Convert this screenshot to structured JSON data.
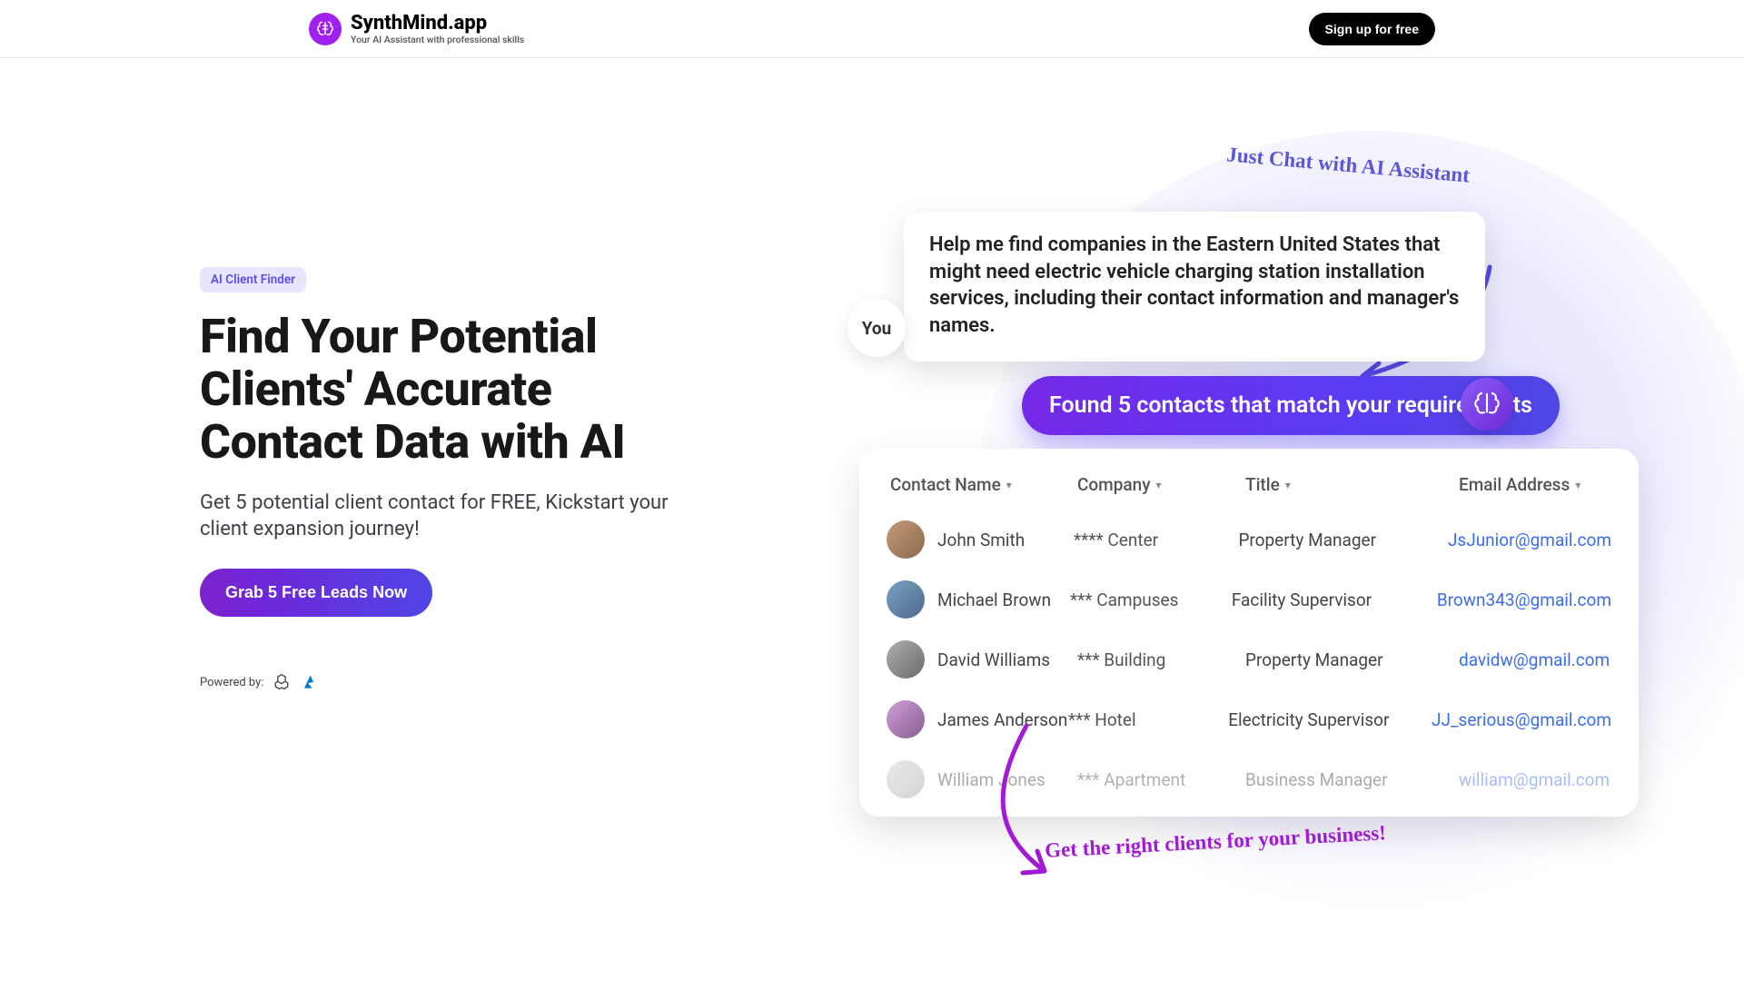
{
  "header": {
    "brand": "SynthMind.app",
    "tagline": "Your AI Assistant with professional skills",
    "signup": "Sign up for free"
  },
  "hero": {
    "badge": "AI Client Finder",
    "headline": "Find Your Potential Clients' Accurate Contact Data with AI",
    "subcopy": "Get 5 potential client contact for FREE, Kickstart your client expansion journey!",
    "cta": "Grab 5 Free Leads Now",
    "powered_label": "Powered by:"
  },
  "illustration": {
    "prompt": "Help me find companies in the Eastern United States that might need electric vehicle charging station installation services, including their contact information and manager's names.",
    "you_label": "You",
    "note_top": "Just Chat with AI Assistant",
    "response": "Found 5 contacts that match your requirements",
    "note_bottom": "Get the right clients for your business!",
    "table": {
      "headers": {
        "name": "Contact Name",
        "company": "Company",
        "title": "Title",
        "email": "Email Address"
      },
      "rows": [
        {
          "name": "John Smith",
          "company": "**** Center",
          "title": "Property Manager",
          "email": "JsJunior@gmail.com"
        },
        {
          "name": "Michael Brown",
          "company": "*** Campuses",
          "title": "Facility Supervisor",
          "email": "Brown343@gmail.com"
        },
        {
          "name": "David Williams",
          "company": "*** Building",
          "title": "Property Manager",
          "email": "davidw@gmail.com"
        },
        {
          "name": "James Anderson",
          "company": "*** Hotel",
          "title": "Electricity Supervisor",
          "email": "JJ_serious@gmail.com"
        },
        {
          "name": "William Jones",
          "company": "*** Apartment",
          "title": "Business Manager",
          "email": "william@gmail.com"
        }
      ]
    }
  }
}
